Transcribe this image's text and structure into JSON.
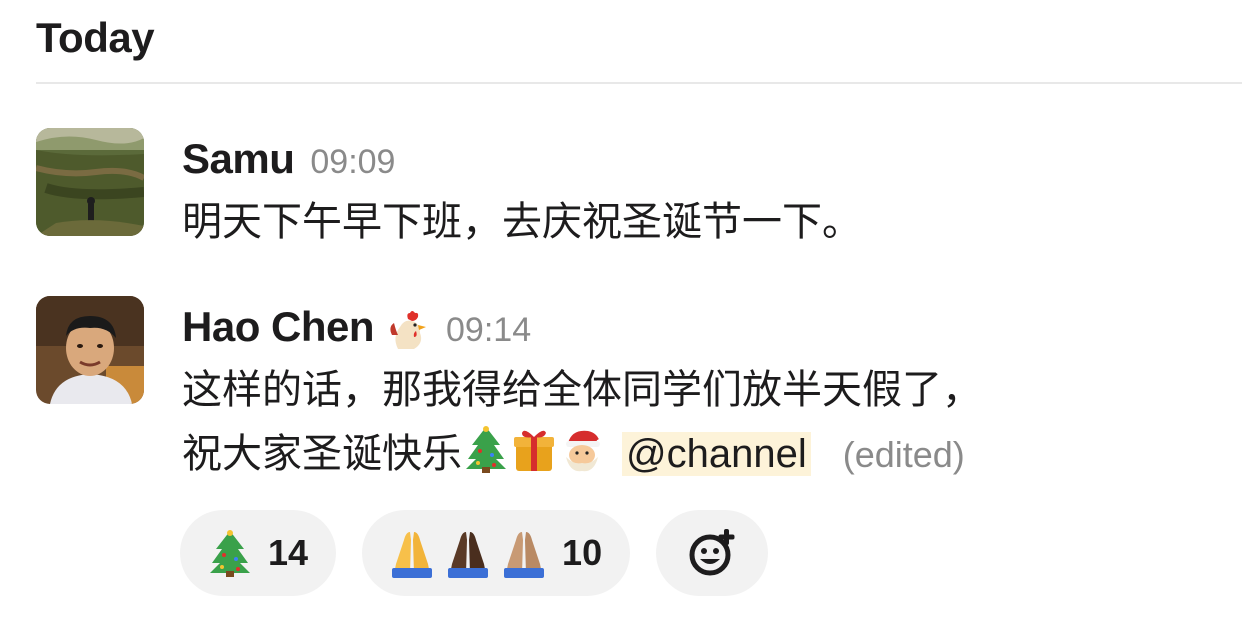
{
  "day_header": "Today",
  "messages": [
    {
      "sender": "Samu",
      "time": "09:09",
      "text": "明天下午早下班，去庆祝圣诞节一下。",
      "avatar_icon": "landscape-photo-avatar"
    },
    {
      "sender": "Hao Chen",
      "status_emoji": "rooster-icon",
      "time": "09:14",
      "text_line1": "这样的话，那我得给全体同学们放半天假了，",
      "text_line2": "祝大家圣诞快乐",
      "inline_emojis": [
        "christmas-tree-icon",
        "gift-icon",
        "santa-icon"
      ],
      "mention": "@channel",
      "edited_label": "(edited)",
      "avatar_icon": "man-portrait-avatar"
    }
  ],
  "reactions": [
    {
      "emojis": [
        "christmas-tree-icon"
      ],
      "count": "14"
    },
    {
      "emojis": [
        "folded-hands-light-icon",
        "folded-hands-dark-icon",
        "folded-hands-medium-icon"
      ],
      "count": "10"
    }
  ],
  "add_reaction_icon": "add-emoji-icon",
  "colors": {
    "mention_bg": "#fdf3d9",
    "reaction_bg": "#f2f2f2",
    "timestamp": "#8a8a8a",
    "divider": "#e8e8e8"
  }
}
